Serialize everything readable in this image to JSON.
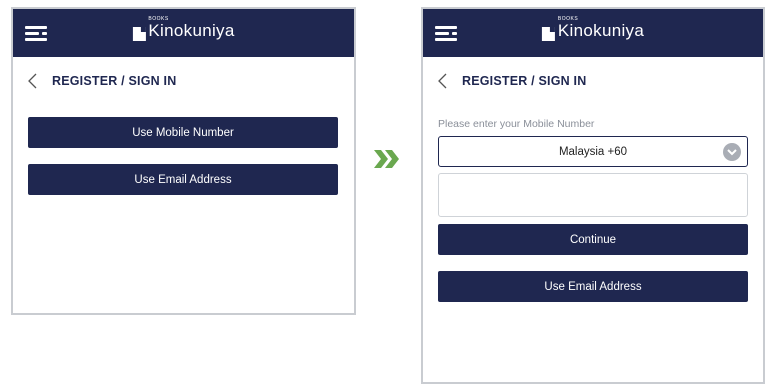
{
  "brand": {
    "small": "BOOKS",
    "name": "Kinokuniya"
  },
  "left_screen": {
    "title": "REGISTER / SIGN IN",
    "mobile_button": "Use Mobile Number",
    "email_button": "Use Email Address"
  },
  "right_screen": {
    "title": "REGISTER / SIGN IN",
    "prompt": "Please enter your Mobile Number",
    "country_selected": "Malaysia +60",
    "mobile_value": "",
    "continue_button": "Continue",
    "email_button": "Use Email Address"
  },
  "colors": {
    "navy": "#1f2750",
    "arrow_green": "#6aa84f",
    "border": "#c9ccd1"
  },
  "icons": [
    "menu-icon",
    "back-icon",
    "chevron-down-icon",
    "double-arrow-icon"
  ]
}
